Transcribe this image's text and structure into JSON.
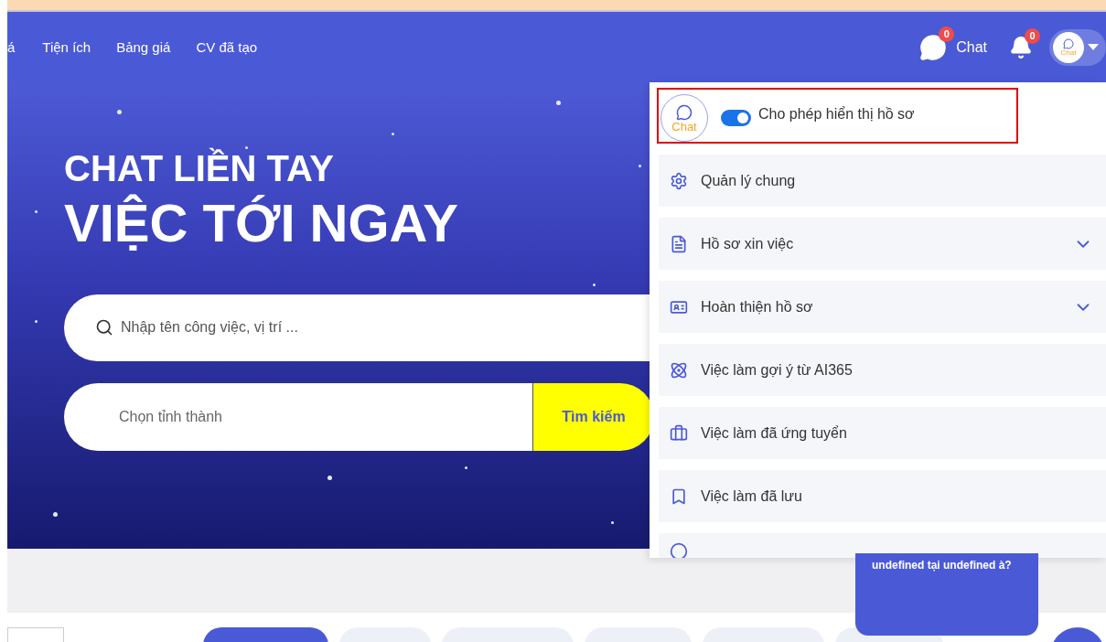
{
  "nav": {
    "items": [
      {
        "label": "á"
      },
      {
        "label": "Tiện ích"
      },
      {
        "label": "Bảng giá"
      },
      {
        "label": "CV đã tạo"
      }
    ],
    "chat": {
      "label": "Chat",
      "badge": "0"
    },
    "notifications": {
      "badge": "0"
    },
    "avatar": {
      "label": "Chat"
    }
  },
  "hero": {
    "title": "CHAT LIỀN TAY",
    "subtitle": "VIỆC TỚI NGAY",
    "search": {
      "placeholder": "Nhập tên công việc, vị trí ..."
    },
    "province": {
      "placeholder": "Chọn tỉnh thành"
    },
    "button": "Tìm kiếm"
  },
  "menu": {
    "avatar": {
      "label": "Chat"
    },
    "visibility": {
      "label": "Cho phép hiển thị hồ sơ",
      "on": true
    },
    "items": [
      {
        "label": "Quản lý chung",
        "expandable": false
      },
      {
        "label": "Hồ sơ xin việc",
        "expandable": true
      },
      {
        "label": "Hoàn thiện hồ sơ",
        "expandable": true
      },
      {
        "label": "Việc làm gợi ý từ AI365",
        "expandable": false
      },
      {
        "label": "Việc làm đã ứng tuyển",
        "expandable": false
      },
      {
        "label": "Việc làm đã lưu",
        "expandable": false
      }
    ]
  },
  "chat_bubble": {
    "text": "undefined tại undefined à?"
  },
  "category_tabs": [
    {
      "selected": true
    },
    {
      "selected": false
    },
    {
      "selected": false
    },
    {
      "selected": false
    },
    {
      "selected": false
    },
    {
      "selected": false
    }
  ]
}
